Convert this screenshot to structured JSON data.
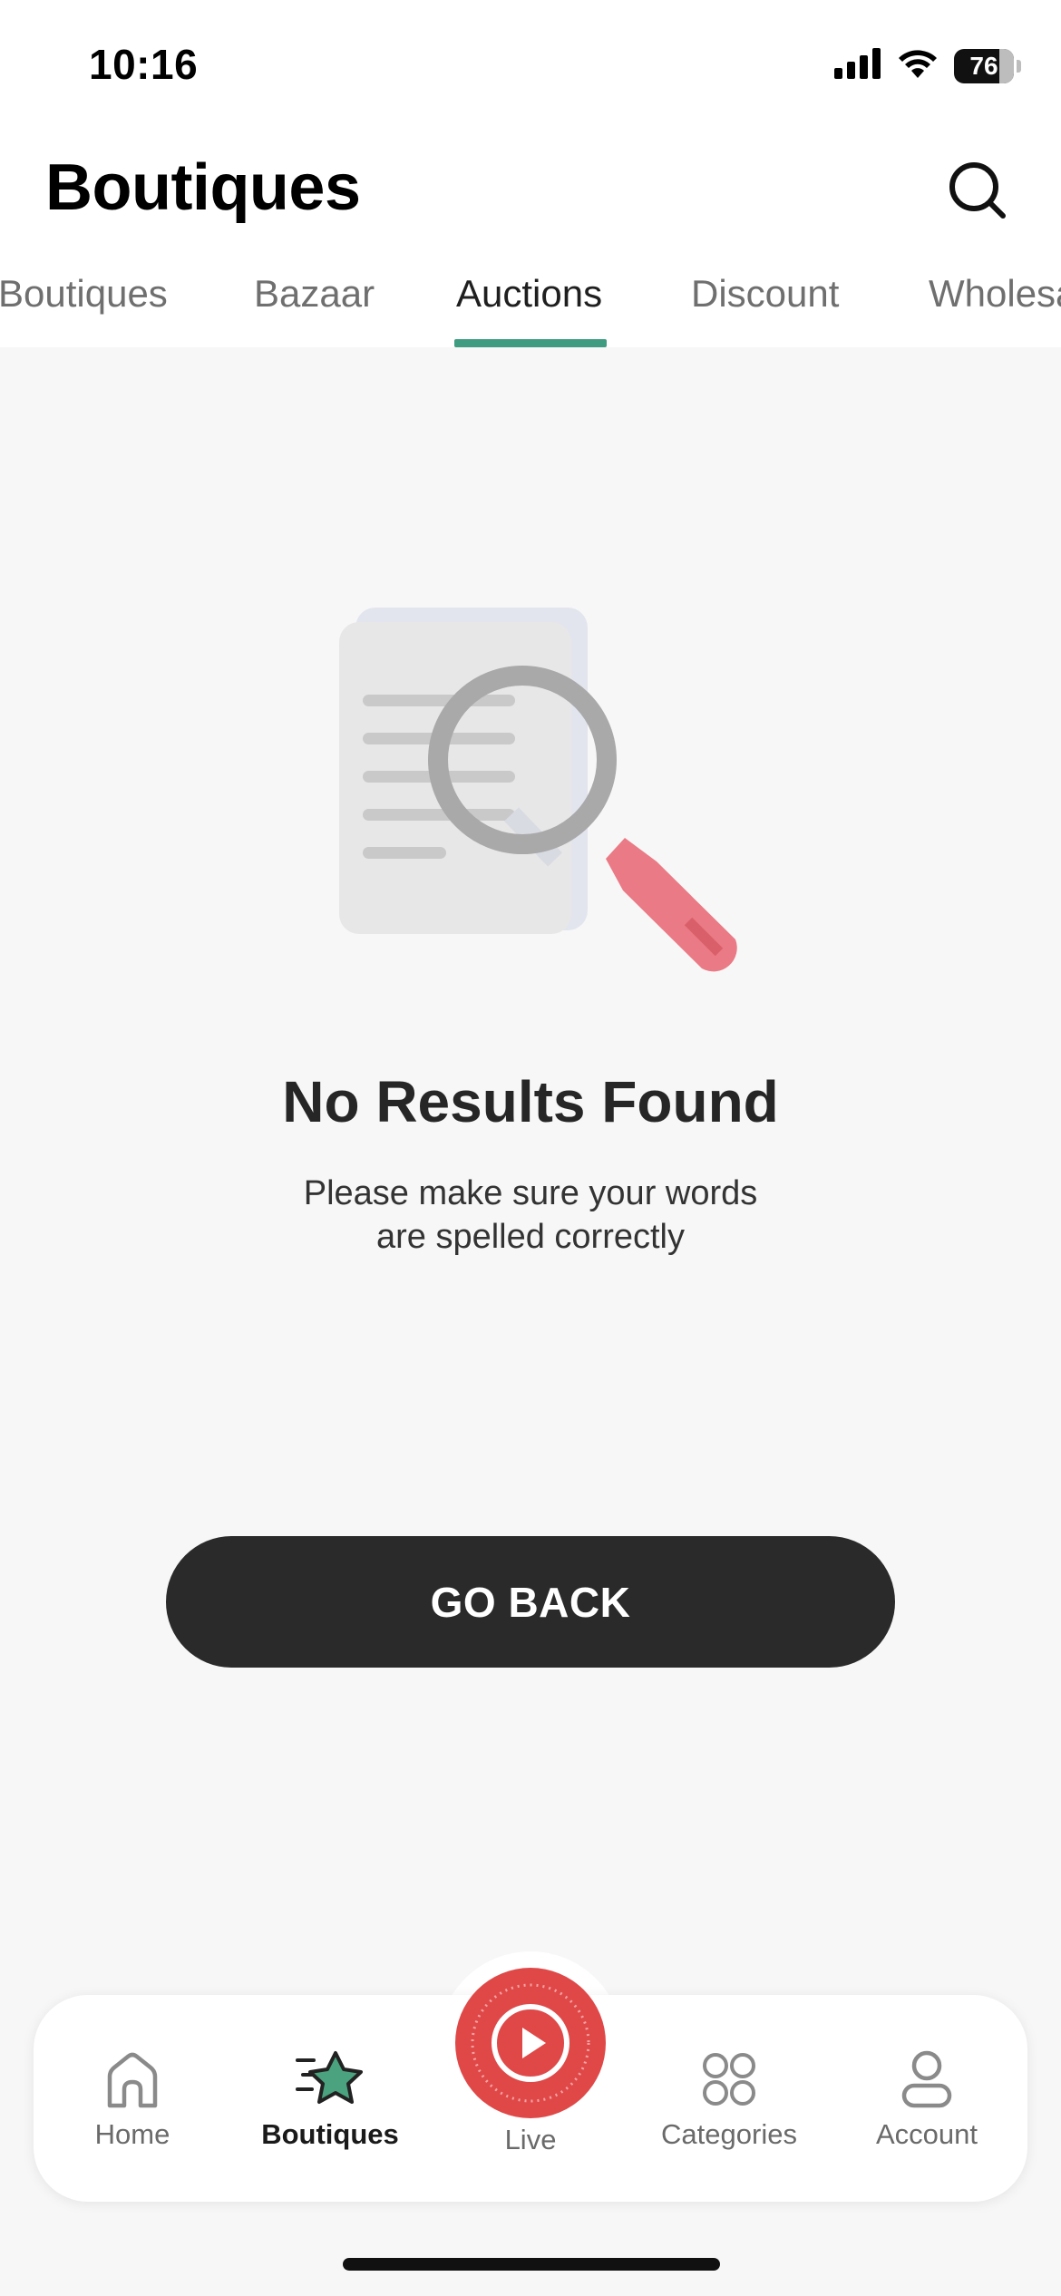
{
  "status_bar": {
    "time": "10:16",
    "battery": "76",
    "icons": [
      "cellular-signal-icon",
      "wifi-icon",
      "battery-icon"
    ]
  },
  "header": {
    "title": "Boutiques",
    "search_icon": "search-icon"
  },
  "tabs": [
    {
      "label": "Boutiques",
      "active": false
    },
    {
      "label": "Bazaar",
      "active": false
    },
    {
      "label": "Auctions",
      "active": true
    },
    {
      "label": "Discount",
      "active": false
    },
    {
      "label": "Wholesa",
      "active": false
    }
  ],
  "empty_state": {
    "illustration": "document-magnifier-illustration",
    "title": "No Results Found",
    "message_line1": "Please make sure your words",
    "message_line2": "are spelled correctly"
  },
  "actions": {
    "go_back_label": "GO BACK"
  },
  "bottom_nav": {
    "items": [
      {
        "label": "Home",
        "icon": "home-icon",
        "active": false
      },
      {
        "label": "Boutiques",
        "icon": "star-icon",
        "active": true
      },
      {
        "label": "Live",
        "icon": "play-icon",
        "active": false
      },
      {
        "label": "Categories",
        "icon": "categories-grid-icon",
        "active": false
      },
      {
        "label": "Account",
        "icon": "account-icon",
        "active": false
      }
    ]
  },
  "colors": {
    "accent": "#3f9c81",
    "live": "#e04848",
    "button": "#2a2a2a",
    "background": "#f7f7f7"
  }
}
